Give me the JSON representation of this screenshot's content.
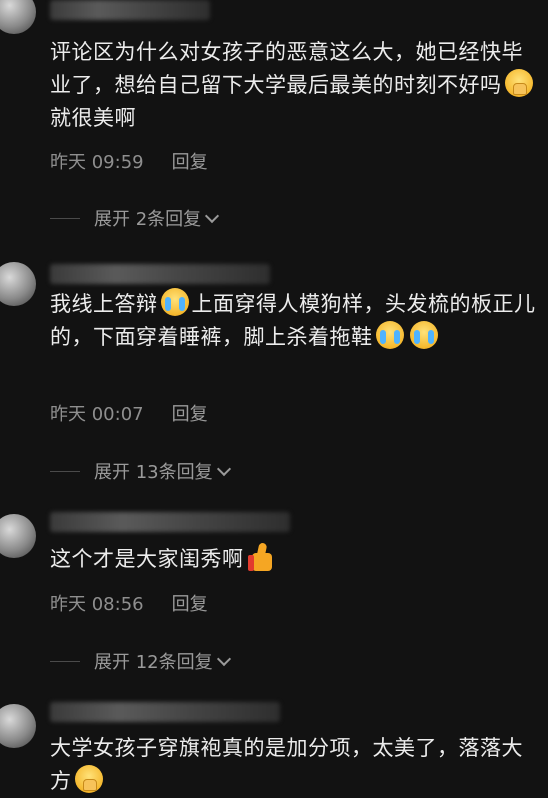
{
  "comments": [
    {
      "text_a": "评论区为什么对女孩子的恶意这么大，她已经快毕业了，想给自己留下大学最后最美的时刻不好吗",
      "text_b": "就很美啊",
      "emoji": "pray-emoji",
      "time": "昨天 09:59",
      "reply": "回复",
      "expand": "展开 2条回复"
    },
    {
      "text_a": "我线上答辩",
      "text_b": "上面穿得人模狗样，头发梳的板正儿的，下面穿着睡裤，脚上杀着拖鞋",
      "emoji": "laugh-cry-emoji",
      "time": "昨天 00:07",
      "reply": "回复",
      "expand": "展开 13条回复"
    },
    {
      "text_a": "这个才是大家闺秀啊",
      "emoji": "thumbs-up-emoji",
      "time": "昨天 08:56",
      "reply": "回复",
      "expand": "展开 12条回复"
    },
    {
      "text_a": "大学女孩子穿旗袍真的是加分项，太美了，落落大方",
      "emoji": "pray-emoji"
    }
  ]
}
